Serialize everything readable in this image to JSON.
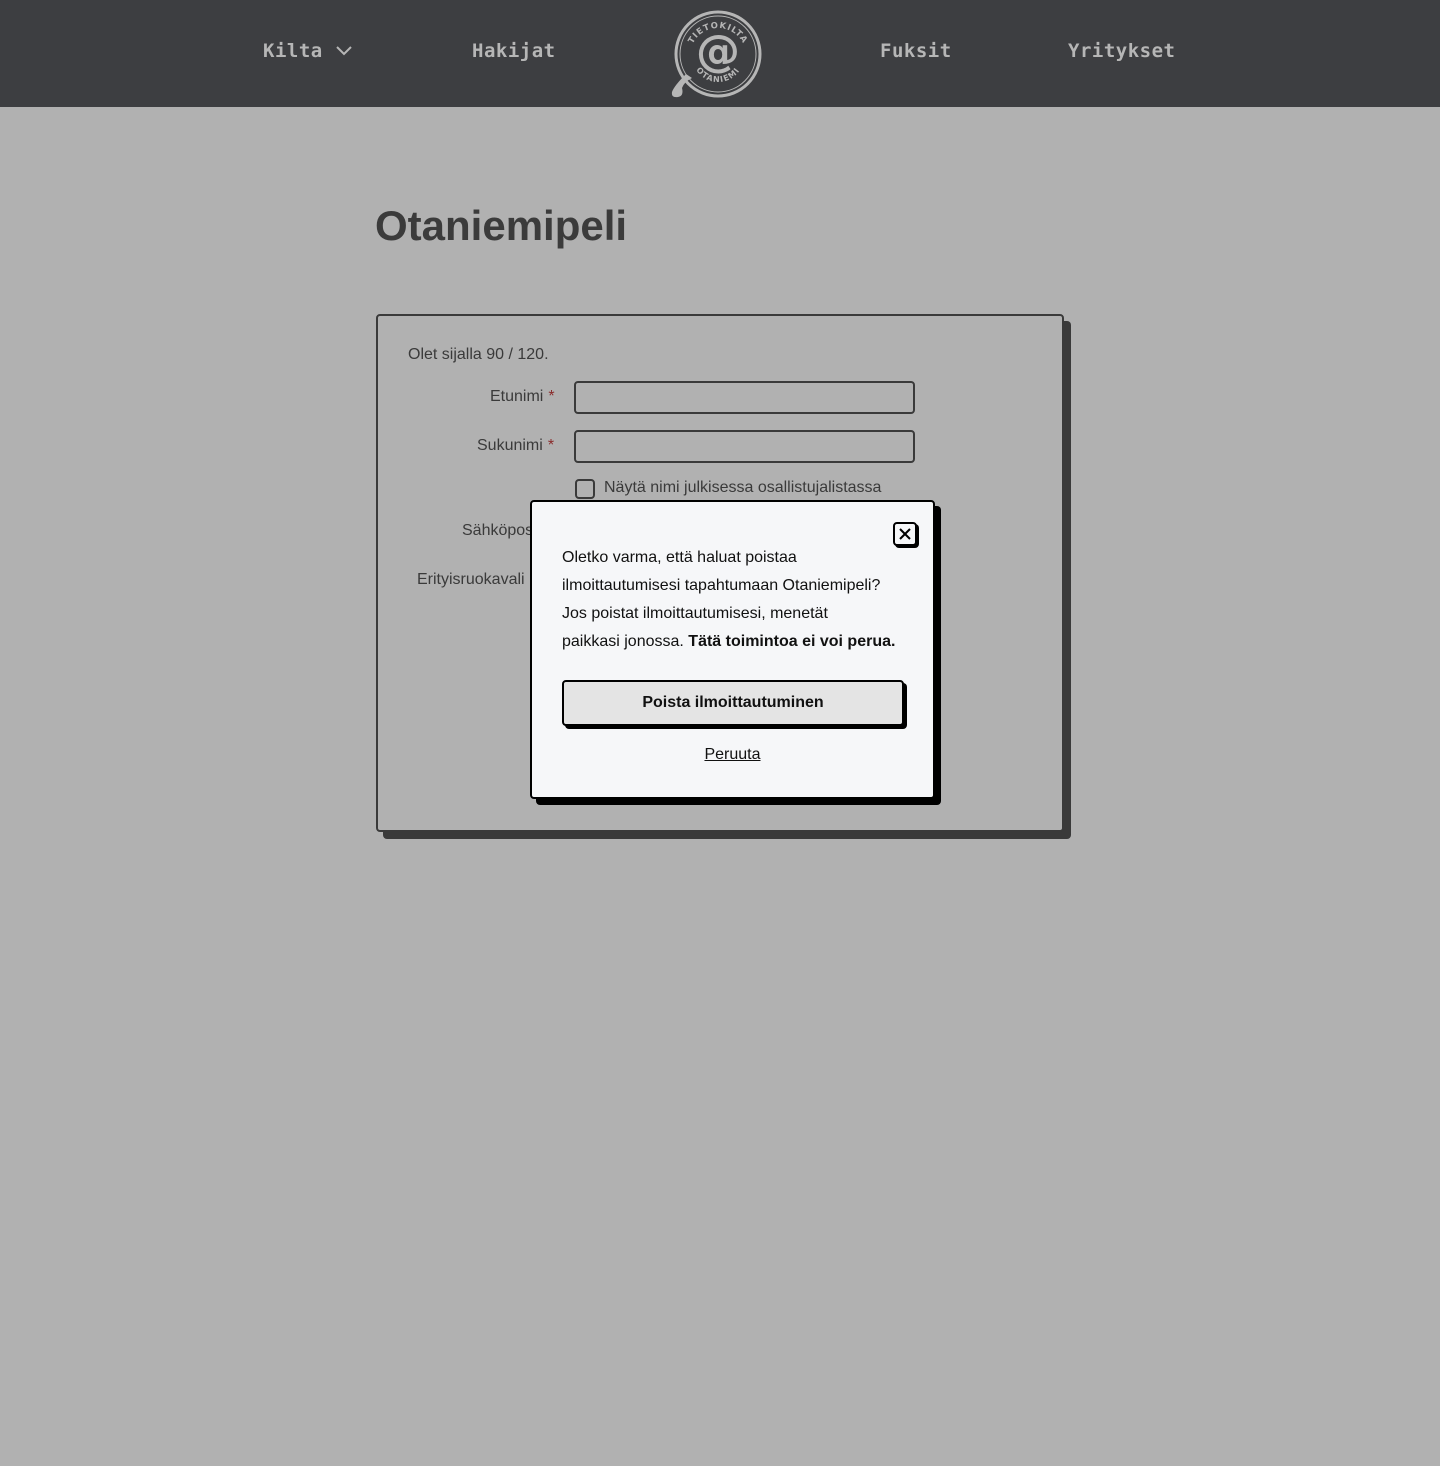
{
  "nav": {
    "items": [
      {
        "label": "Kilta",
        "has_dropdown": true
      },
      {
        "label": "Hakijat"
      },
      {
        "label": "Fuksit"
      },
      {
        "label": "Yritykset"
      }
    ],
    "logo": {
      "top_text": "TIETOKILTA",
      "bottom_text": "OTANIEMI",
      "symbol": "@"
    }
  },
  "page": {
    "title": "Otaniemipeli"
  },
  "form": {
    "queue_status": "Olet sijalla 90 / 120.",
    "first_name_label": "Etunimi",
    "last_name_label": "Sukunimi",
    "required_mark": "*",
    "public_name_checkbox_label": "Näytä nimi julkisessa osallistujalistassa",
    "email_label_partial": "Sähköpos",
    "diet_label_partial": "Erityisruokavali"
  },
  "modal": {
    "text_line1": "Oletko varma, että haluat poistaa",
    "text_line2": "ilmoittautumisesi tapahtumaan Otaniemipeli?",
    "text_line3": "Jos poistat ilmoittautumisesi, menetät",
    "text_line4": "paikkasi jonossa.",
    "text_bold": "Tätä toimintoa ei voi perua.",
    "delete_button": "Poista ilmoittautuminen",
    "cancel_link": "Peruuta"
  },
  "colors": {
    "navbar_bg": "#3d3e41",
    "overlay_bg": "#b1b1b1",
    "modal_bg": "#f6f7f9",
    "required": "#8a2a2a"
  }
}
